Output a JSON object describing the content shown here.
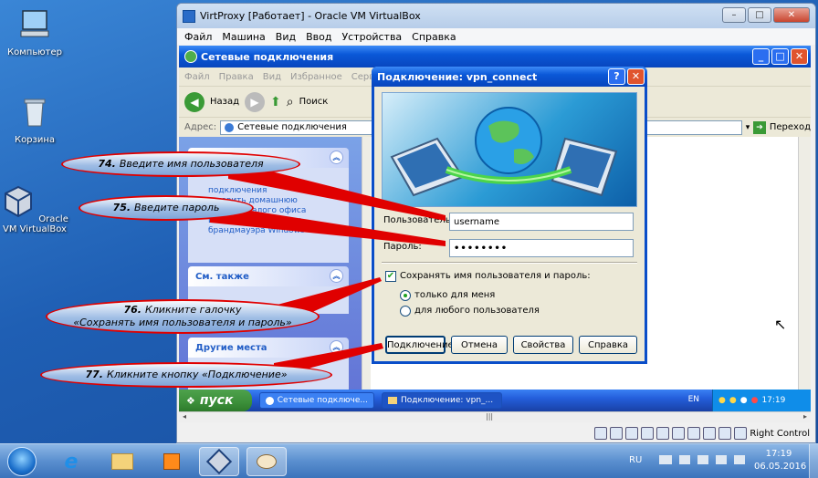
{
  "desktop": {
    "icons": [
      {
        "label": "Компьютер"
      },
      {
        "label": "Корзина"
      },
      {
        "label": "Oracle VM VirtualBox"
      }
    ]
  },
  "vbox": {
    "title": "VirtProxy [Работает] - Oracle VM VirtualBox",
    "menu": [
      "Файл",
      "Машина",
      "Вид",
      "Ввод",
      "Устройства",
      "Справка"
    ],
    "host_key": "Right Control"
  },
  "explorer": {
    "title": "Сетевые подключения",
    "menu": [
      "Файл",
      "Правка",
      "Вид",
      "Избранное",
      "Серв"
    ],
    "back_label": "Назад",
    "search_label": "Поиск",
    "address_label": "Адрес:",
    "address_value": "Сетевые подключения",
    "go_label": "Переход",
    "taskpane": {
      "box1_items": [
        "подключения",
        "...новить домашнюю",
        "...и сеть малого офиса",
        "Изменить параметры",
        "брандмауэра Windows"
      ],
      "see_also": "См. также",
      "other_places": "Другие места"
    }
  },
  "xp_taskbar": {
    "start_label": "пуск",
    "tasks": [
      "Сетевые подключе...",
      "Подключение: vpn_..."
    ],
    "lang": "EN",
    "clock": "17:19"
  },
  "dialog": {
    "title": "Подключение: vpn_connect",
    "user_label": "Пользователь:",
    "user_value": "username",
    "password_label": "Пароль:",
    "password_value": "password",
    "save_label": "Сохранять имя пользователя и пароль:",
    "save_checked": true,
    "only_me_label": "только для меня",
    "anyone_label": "для любого пользователя",
    "buttons": {
      "connect": "Подключение",
      "cancel": "Отмена",
      "props": "Свойства",
      "help": "Справка"
    }
  },
  "callouts": {
    "c74": {
      "num": "74.",
      "text": "Введите имя пользователя"
    },
    "c75": {
      "num": "75.",
      "text": "Введите пароль"
    },
    "c76": {
      "num": "76.",
      "text": "Кликните галочку",
      "text2": "«Сохранять имя пользователя и пароль»"
    },
    "c77": {
      "num": "77.",
      "text": "Кликните кнопку  «Подключение»"
    }
  },
  "w7_taskbar": {
    "lang": "RU",
    "time": "17:19",
    "date": "06.05.2016"
  },
  "colors": {
    "callout_border": "#e00000",
    "xp_blue": "#0a58d8",
    "xp_green": "#3c8f3a"
  }
}
